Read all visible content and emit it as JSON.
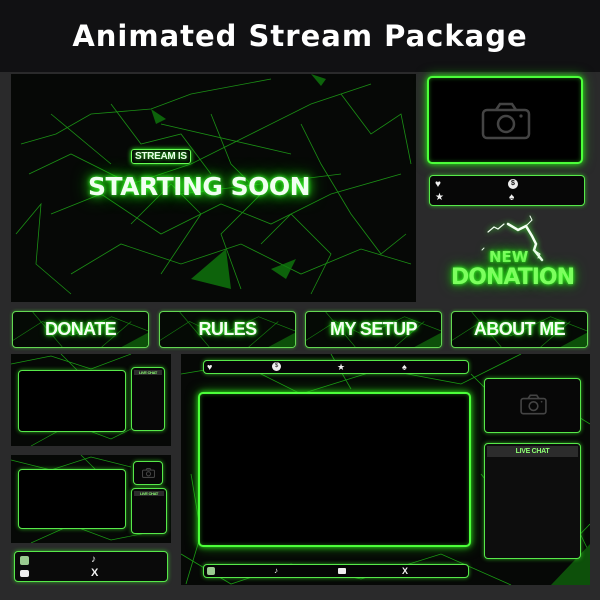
{
  "header": {
    "title": "Animated Stream Package"
  },
  "colors": {
    "accent": "#4cff3a",
    "background": "#2a2a2b",
    "header_bg": "#111113",
    "panel_bg": "#060806"
  },
  "starting_soon": {
    "badge": "STREAM IS",
    "title": "STARTING SOON"
  },
  "webcam_frame": {
    "icon": "camera-icon"
  },
  "stats_bar": {
    "icons": [
      "heart-icon",
      "dollar-coin-icon",
      "star-icon",
      "drop-icon"
    ]
  },
  "donation_alert": {
    "line1": "NEW",
    "line2": "DONATION",
    "icon": "lightning-icon"
  },
  "panels": [
    {
      "label": "DONATE"
    },
    {
      "label": "RULES"
    },
    {
      "label": "MY SETUP"
    },
    {
      "label": "ABOUT ME"
    }
  ],
  "overlay_small_1": {
    "chat_label": "LIVE CHAT"
  },
  "overlay_small_2": {
    "chat_label": "LIVE CHAT",
    "icon": "camera-icon"
  },
  "socials_bar": {
    "icons": [
      "instagram-icon",
      "tiktok-icon",
      "youtube-icon",
      "x-icon"
    ]
  },
  "main_overlay": {
    "top_icons": [
      "heart-icon",
      "dollar-coin-icon",
      "star-icon",
      "drop-icon"
    ],
    "chat_label": "LIVE CHAT",
    "bottom_icons": [
      "instagram-icon",
      "tiktok-icon",
      "youtube-icon",
      "x-icon"
    ]
  }
}
